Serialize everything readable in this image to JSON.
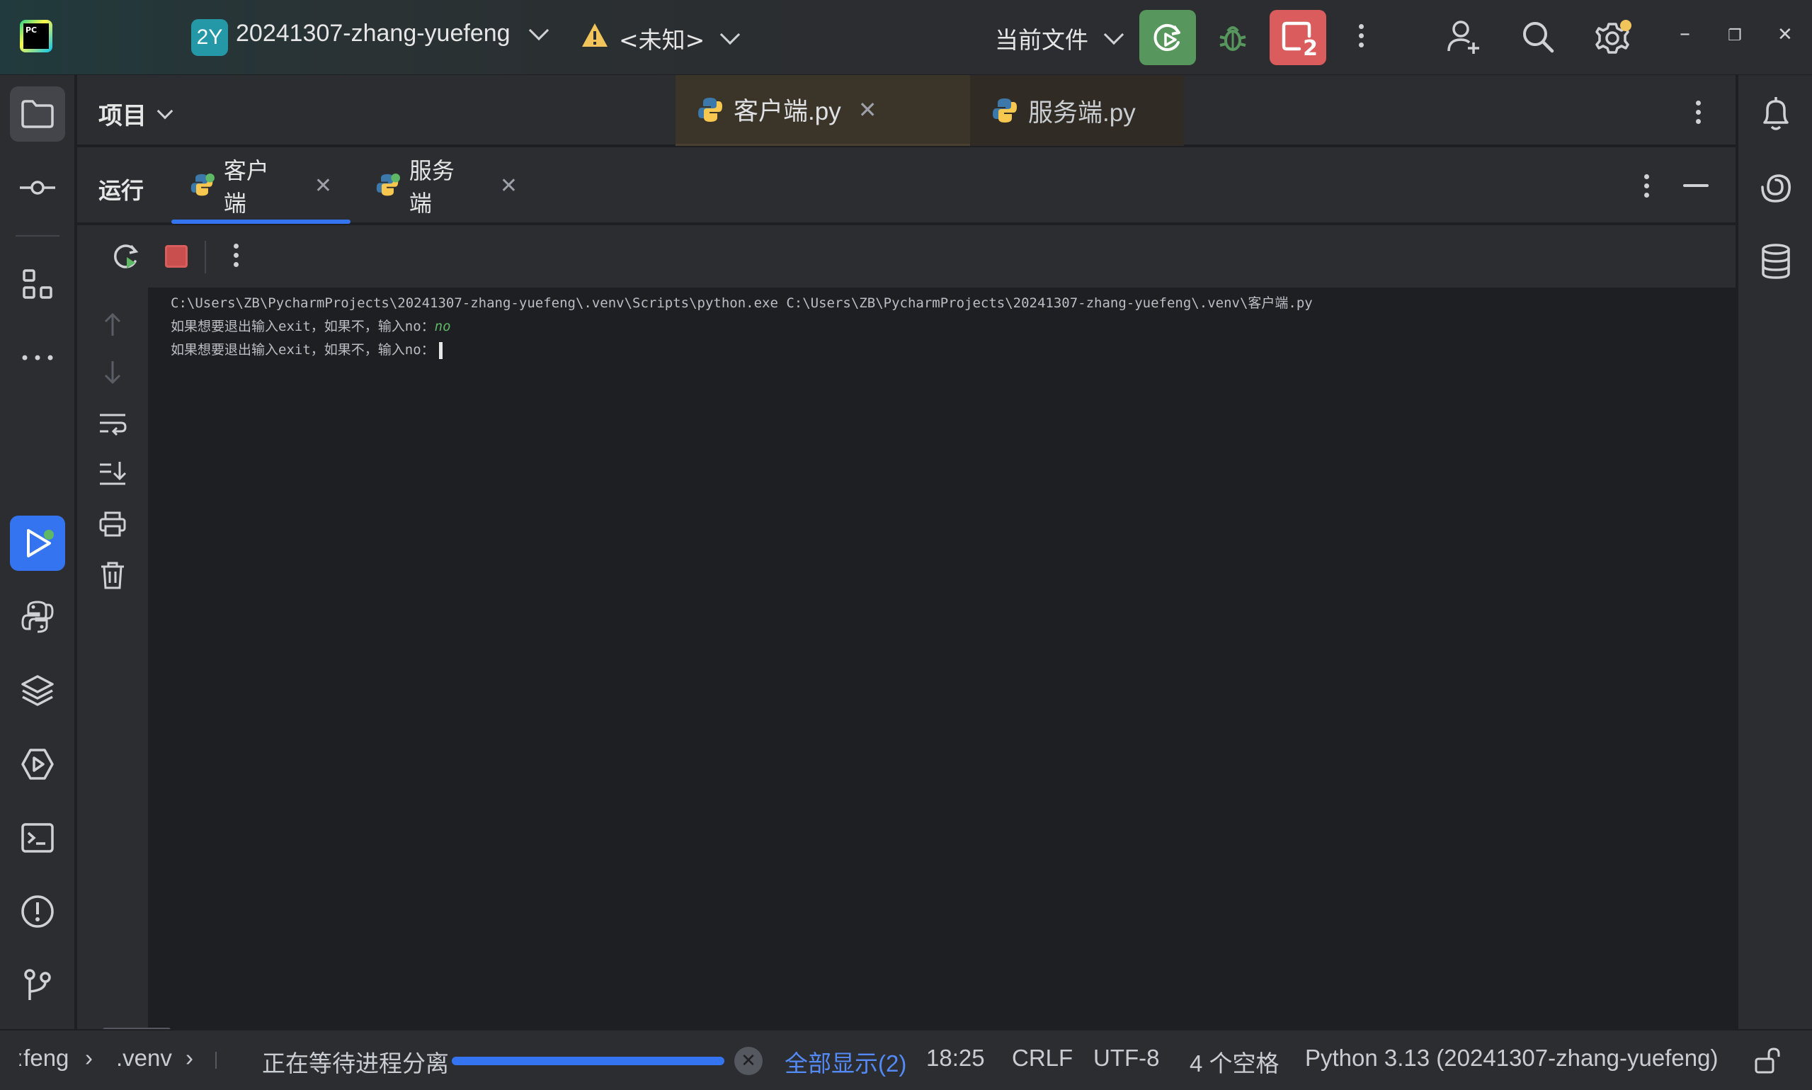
{
  "titlebar": {
    "app_logo_text": "PC",
    "project_badge": "2Y",
    "project_name": "20241307-zhang-yuefeng",
    "run_config": "<未知>",
    "current_file": "当前文件",
    "stop_count": "2",
    "minimize": "–",
    "restore": "❐",
    "close": "✕"
  },
  "project_panel": {
    "title": "项目"
  },
  "editor_tabs": [
    {
      "label": "客户端.py"
    },
    {
      "label": "服务端.py"
    }
  ],
  "run_panel": {
    "title": "运行",
    "tabs": [
      {
        "label": "客户端"
      },
      {
        "label": "服务端"
      }
    ]
  },
  "console": {
    "lines": [
      "C:\\Users\\ZB\\PycharmProjects\\20241307-zhang-yuefeng\\.venv\\Scripts\\python.exe C:\\Users\\ZB\\PycharmProjects\\20241307-zhang-yuefeng\\.venv\\客户端.py",
      "如果想要退出输入exit，如果不，输入no：",
      "如果想要退出输入exit，如果不，输入no："
    ],
    "user_input": "no"
  },
  "statusbar": {
    "breadcrumb_1": "ːfeng",
    "breadcrumb_2": ".venv",
    "process_status": "正在等待进程分离",
    "show_all": "全部显示(2)",
    "position": "18:25",
    "line_sep": "CRLF",
    "encoding": "UTF-8",
    "indent": "4 个空格",
    "interpreter": "Python 3.13 (20241307-zhang-yuefeng)",
    "progress": 1.0
  },
  "colors": {
    "accent": "#3574f0",
    "run_green": "#57965c",
    "stop_red": "#db5c5c",
    "input_green": "#5fb865",
    "bg": "#1e1f22",
    "panel": "#2b2d30"
  }
}
